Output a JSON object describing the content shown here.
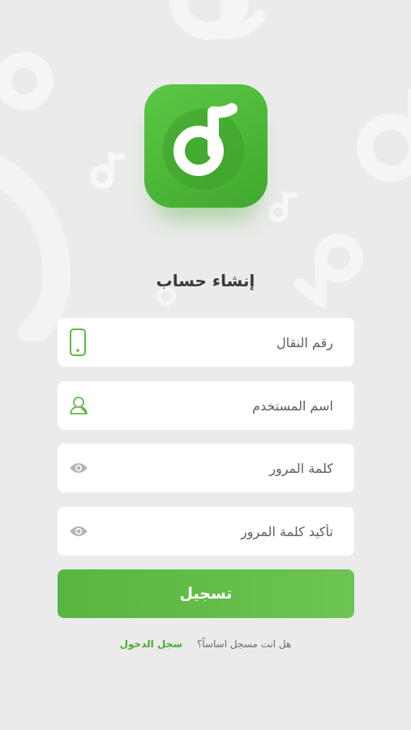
{
  "logo": {
    "icon": "music-note-icon",
    "color": "#4db538"
  },
  "title": "إنشاء حساب",
  "fields": {
    "mobile": {
      "placeholder": "رقم النقال",
      "icon": "phone-icon"
    },
    "username": {
      "placeholder": "اسم المستخدم",
      "icon": "user-icon"
    },
    "password": {
      "placeholder": "كلمة المرور",
      "icon": "eye-icon"
    },
    "confirm_password": {
      "placeholder": "تأكيد كلمة المرور",
      "icon": "eye-icon"
    }
  },
  "register_button": "تسجيل",
  "footer": {
    "question": "هل انت مسجل اساساً؟",
    "login_link": "سجل الدخول"
  },
  "colors": {
    "accent": "#5dbb44",
    "background": "#ebebeb"
  }
}
